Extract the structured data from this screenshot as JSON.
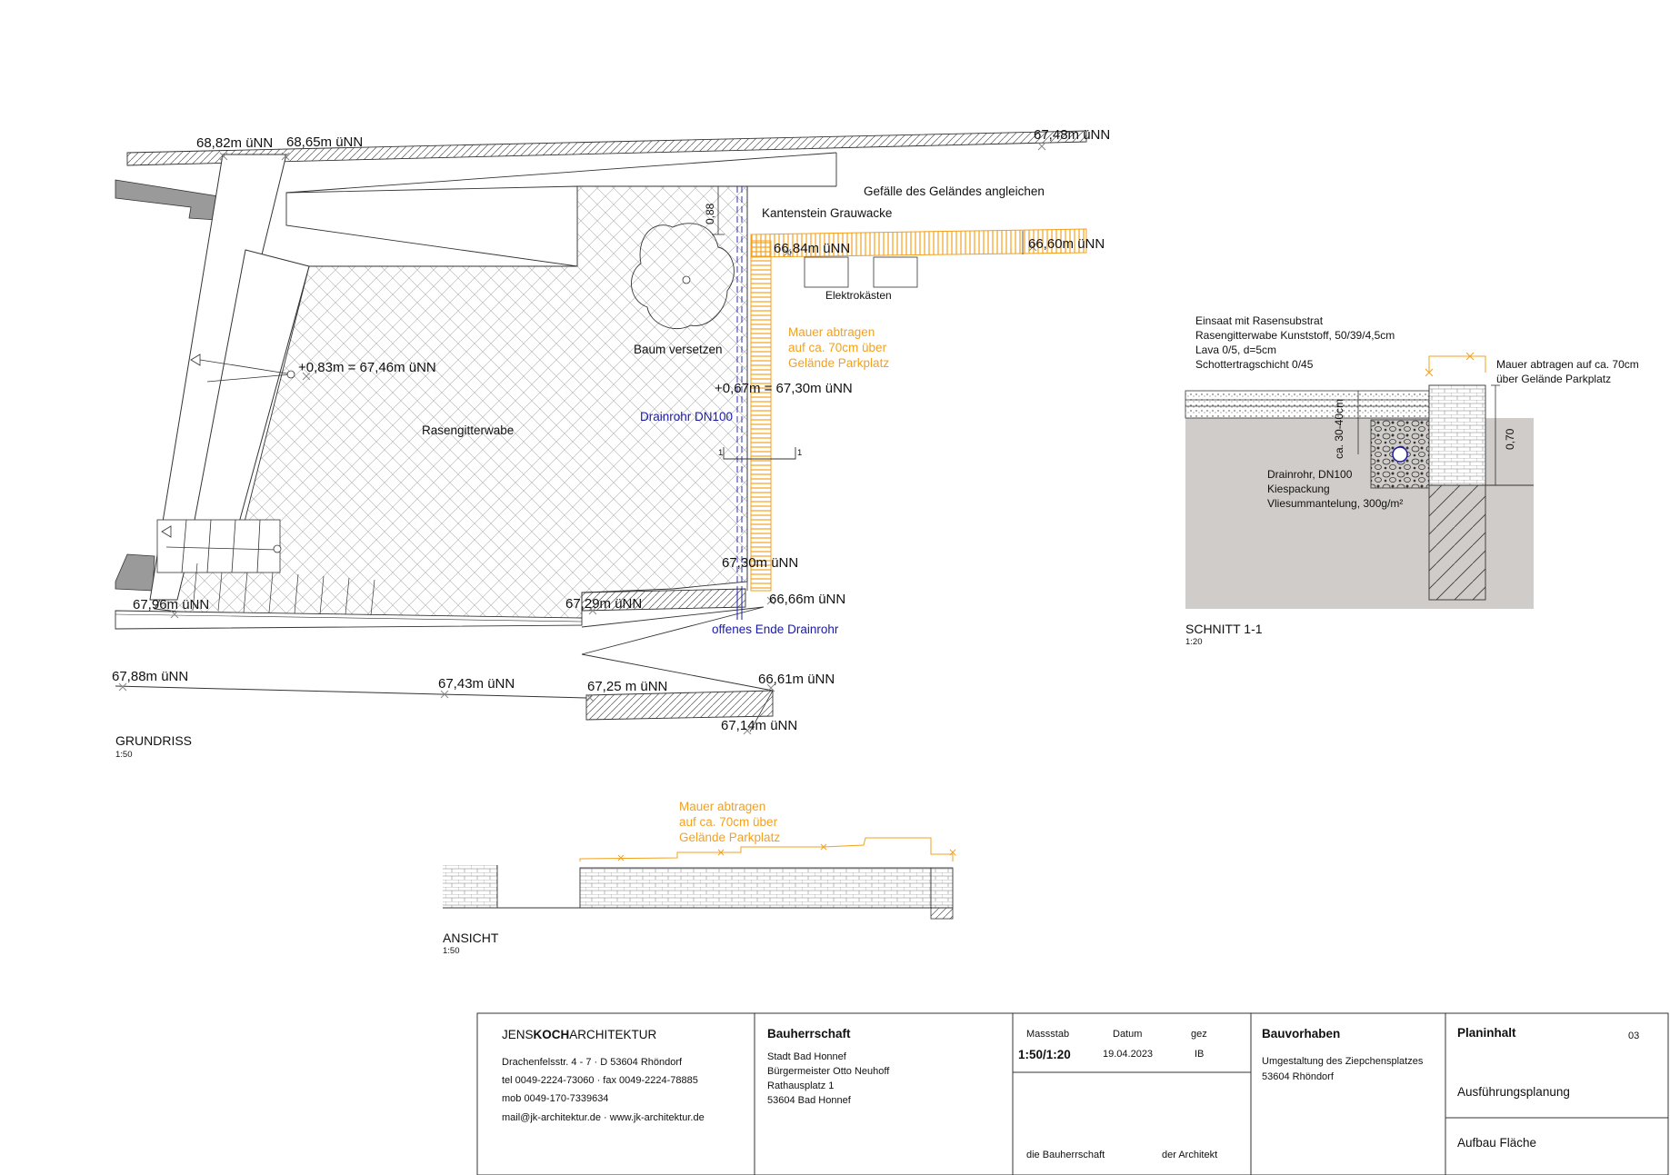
{
  "grundriss": {
    "title": "GRUNDRISS",
    "scale": "1:50",
    "levels": {
      "l1": "68,82m üNN",
      "l2": "68,65m üNN",
      "l3": "67,48m üNN",
      "l4": "66,84m üNN",
      "l5": "66,60m üNN",
      "l6": "+0,83m = 67,46m üNN",
      "l7": "+0,67m = 67,30m üNN",
      "l8": "67,30m üNN",
      "l9": "66,66m üNN",
      "l10": "67,96m üNN",
      "l11": "67,29m üNN",
      "l12": "67,88m üNN",
      "l13": "67,43m üNN",
      "l14": "67,25 m üNN",
      "l15": "66,61m üNN",
      "l16": "67,14m üNN"
    },
    "labels": {
      "gefaelle": "Gefälle des Geländes angleichen",
      "kantenstein": "Kantenstein Grauwacke",
      "elektro": "Elektrokästen",
      "baum": "Baum versetzen",
      "rasen": "Rasengitterwabe",
      "mauer1": "Mauer abtragen",
      "mauer2": "auf ca. 70cm über",
      "mauer3": "Gelände Parkplatz",
      "drain": "Drainrohr DN100",
      "offen": "offenes Ende Drainrohr",
      "dim": "0,88",
      "sec_a": "1",
      "sec_b": "1"
    }
  },
  "schnitt": {
    "title": "SCHNITT 1-1",
    "scale": "1:20",
    "layers": {
      "a": "Einsaat mit Rasensubstrat",
      "b": "Rasengitterwabe Kunststoff, 50/39/4,5cm",
      "c": "Lava 0/5, d=5cm",
      "d": "Schottertragschicht 0/45"
    },
    "mauer1": "Mauer abtragen auf ca. 70cm",
    "mauer2": "über Gelände Parkplatz",
    "dim_v": "0,70",
    "dim_depth": "ca. 30-40cm",
    "drain1": "Drainrohr, DN100",
    "drain2": "Kiespackung",
    "drain3": "Vliesummantelung, 300g/m²"
  },
  "ansicht": {
    "title": "ANSICHT",
    "scale": "1:50",
    "mauer1": "Mauer abtragen",
    "mauer2": "auf ca. 70cm über",
    "mauer3": "Gelände Parkplatz"
  },
  "titleblock": {
    "firm_pre": "JENS",
    "firm_mid": "KOCH",
    "firm_post": "ARCHITEKTUR",
    "addr1": "Drachenfelsstr. 4 - 7 · D 53604 Rhöndorf",
    "addr2": "tel 0049-2224-73060 · fax 0049-2224-78885",
    "addr3": "mob 0049-170-7339634",
    "addr4": "mail@jk-architektur.de · www.jk-architektur.de",
    "bauherr_h": "Bauherrschaft",
    "bauherr1": "Stadt Bad Honnef",
    "bauherr2": "Bürgermeister Otto Neuhoff",
    "bauherr3": "Rathausplatz 1",
    "bauherr4": "53604 Bad Honnef",
    "massstab_h": "Massstab",
    "datum_h": "Datum",
    "gez_h": "gez",
    "massstab": "1:50/1:20",
    "datum": "19.04.2023",
    "gez": "IB",
    "sign1": "die Bauherrschaft",
    "sign2": "der Architekt",
    "vorhaben_h": "Bauvorhaben",
    "vorhaben1": "Umgestaltung des Ziepchensplatzes",
    "vorhaben2": "53604 Rhöndorf",
    "plan_h": "Planinhalt",
    "plan_nr": "03",
    "plan1": "Ausführungsplanung",
    "plan2": "Aufbau Fläche"
  },
  "colors": {
    "orange": "#f2a11f",
    "blue": "#1a1aa8",
    "ground": "#cfccc9",
    "hatch": "#a9a9a9"
  }
}
